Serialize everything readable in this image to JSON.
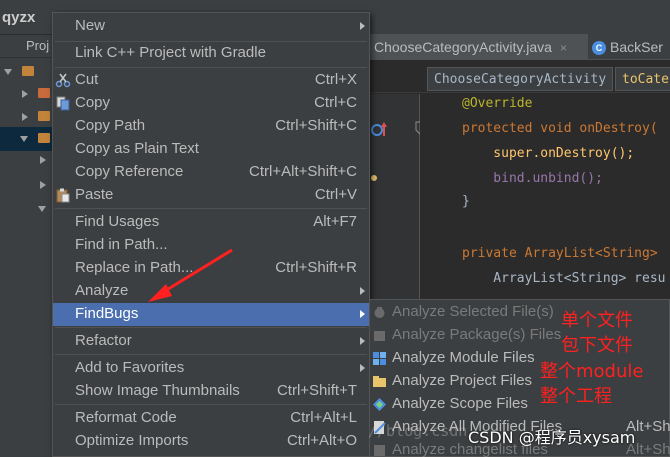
{
  "app": {
    "title": "qyzx",
    "project_tab": "Proj"
  },
  "editor": {
    "tabs": [
      {
        "label": "ChooseCategoryActivity.java",
        "close": "×"
      },
      {
        "label": "BackSer",
        "icon_text": "C"
      }
    ],
    "breadcrumbs": [
      "ChooseCategoryActivity",
      "toCate"
    ],
    "code": [
      "@Override",
      "protected void onDestroy(",
      "    super.onDestroy();",
      "    bind.unbind();",
      "}",
      "private ArrayList<String>",
      "    ArrayList<String> resu"
    ]
  },
  "context_menu": {
    "items": [
      {
        "label": "New",
        "shortcut": "",
        "submenu": true
      },
      {
        "label": "Link C++ Project with Gradle",
        "shortcut": ""
      },
      {
        "label": "Cut",
        "shortcut": "Ctrl+X",
        "icon": "scissors-icon"
      },
      {
        "label": "Copy",
        "shortcut": "Ctrl+C",
        "icon": "copy-icon"
      },
      {
        "label": "Copy Path",
        "shortcut": "Ctrl+Shift+C"
      },
      {
        "label": "Copy as Plain Text",
        "shortcut": ""
      },
      {
        "label": "Copy Reference",
        "shortcut": "Ctrl+Alt+Shift+C"
      },
      {
        "label": "Paste",
        "shortcut": "Ctrl+V",
        "icon": "paste-icon"
      },
      {
        "label": "Find Usages",
        "shortcut": "Alt+F7"
      },
      {
        "label": "Find in Path...",
        "shortcut": ""
      },
      {
        "label": "Replace in Path...",
        "shortcut": "Ctrl+Shift+R"
      },
      {
        "label": "Analyze",
        "shortcut": "",
        "submenu": true
      },
      {
        "label": "FindBugs",
        "shortcut": "",
        "submenu": true,
        "highlighted": true
      },
      {
        "label": "Refactor",
        "shortcut": "",
        "submenu": true
      },
      {
        "label": "Add to Favorites",
        "shortcut": "",
        "submenu": true
      },
      {
        "label": "Show Image Thumbnails",
        "shortcut": "Ctrl+Shift+T"
      },
      {
        "label": "Reformat Code",
        "shortcut": "Ctrl+Alt+L"
      },
      {
        "label": "Optimize Imports",
        "shortcut": "Ctrl+Alt+O"
      }
    ]
  },
  "findbugs_submenu": {
    "items": [
      {
        "label": "Analyze Selected File(s)",
        "shortcut": "",
        "disabled": true
      },
      {
        "label": "Analyze Package(s) Files",
        "shortcut": "",
        "disabled": true
      },
      {
        "label": "Analyze Module Files",
        "shortcut": ""
      },
      {
        "label": "Analyze Project Files",
        "shortcut": ""
      },
      {
        "label": "Analyze Scope Files",
        "shortcut": ""
      },
      {
        "label": "Analyze All Modified Files",
        "shortcut": "Alt+Shift+"
      },
      {
        "label": "Analyze changelist files",
        "shortcut": "Alt+Shift+",
        "disabled": true
      }
    ]
  },
  "annotations": [
    "单个文件",
    "包下文件",
    "整个module",
    "整个工程"
  ],
  "watermark": "CSDN @程序员xysam",
  "faint_url": "//blog.csdn",
  "colors": {
    "accent": "#4b6eaf",
    "annotation": "#ff2020",
    "menu_bg": "#3c3f41"
  }
}
